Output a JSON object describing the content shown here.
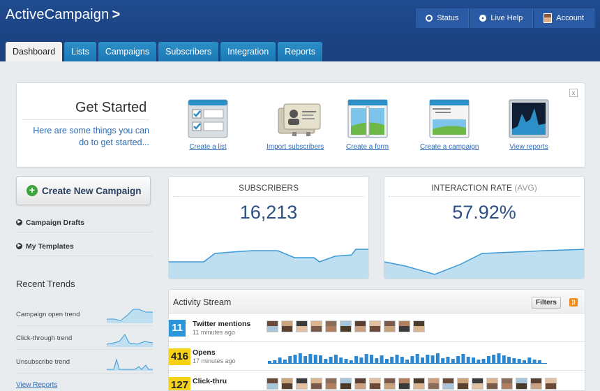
{
  "header": {
    "logo": "ActiveCampaign",
    "logo_chevron": ">",
    "buttons": [
      {
        "label": "Status",
        "icon": "status-icon"
      },
      {
        "label": "Live Help",
        "icon": "help-icon"
      },
      {
        "label": "Account",
        "icon": "account-avatar"
      }
    ]
  },
  "tabs": [
    {
      "label": "Dashboard",
      "active": true
    },
    {
      "label": "Lists",
      "active": false
    },
    {
      "label": "Campaigns",
      "active": false
    },
    {
      "label": "Subscribers",
      "active": false
    },
    {
      "label": "Integration",
      "active": false
    },
    {
      "label": "Reports",
      "active": false
    }
  ],
  "get_started": {
    "title": "Get Started",
    "subtitle": "Here are some things you can do to get started...",
    "close": "x",
    "items": [
      {
        "label": "Create a list",
        "icon": "list-icon"
      },
      {
        "label": "Import subscribers",
        "icon": "contact-cards-icon"
      },
      {
        "label": "Create a form",
        "icon": "form-icon"
      },
      {
        "label": "Create a campaign",
        "icon": "campaign-icon"
      },
      {
        "label": "View reports",
        "icon": "reports-icon"
      }
    ]
  },
  "left": {
    "create_campaign": "Create New Campaign",
    "links": [
      "Campaign Drafts",
      "My Templates"
    ],
    "recent_trends_title": "Recent Trends",
    "trends": [
      "Campaign open trend",
      "Click-through trend",
      "Unsubscribe trend"
    ],
    "view_reports": "View Reports"
  },
  "stats": {
    "subscribers": {
      "label": "SUBSCRIBERS",
      "value": "16,213"
    },
    "interaction": {
      "label": "INTERACTION RATE",
      "label_suffix": "(AVG)",
      "value": "57.92%"
    }
  },
  "stream": {
    "title": "Activity Stream",
    "filters": "Filters",
    "rows": [
      {
        "count": "11",
        "name": "Twitter mentions",
        "time": "11 minutes ago",
        "color": "blue",
        "kind": "avatars"
      },
      {
        "count": "416",
        "name": "Opens",
        "time": "17 minutes ago",
        "color": "yellow",
        "kind": "bars"
      },
      {
        "count": "127",
        "name": "Click-thru",
        "time": "",
        "color": "yellow",
        "kind": "avatars"
      }
    ]
  },
  "colors": {
    "header_blue": "#1f4b8f",
    "tab_blue": "#2c8fc7",
    "link_blue": "#2f6bb3",
    "chart_fill": "#bfdff1",
    "chart_line": "#3b9ad6",
    "badge_blue": "#2b97d8",
    "badge_yellow": "#f5d118"
  }
}
